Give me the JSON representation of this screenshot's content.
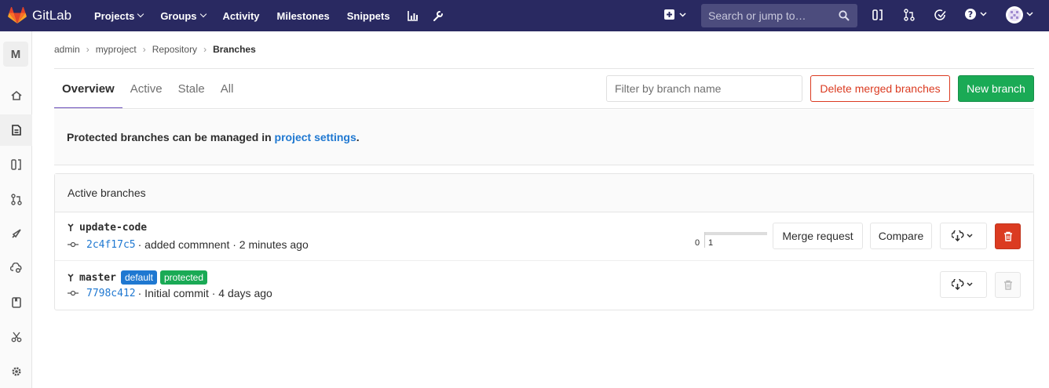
{
  "topbar": {
    "brand": "GitLab",
    "nav": [
      "Projects",
      "Groups",
      "Activity",
      "Milestones",
      "Snippets"
    ],
    "search_placeholder": "Search or jump to…"
  },
  "sidebar": {
    "project_letter": "M"
  },
  "breadcrumb": [
    "admin",
    "myproject",
    "Repository",
    "Branches"
  ],
  "tabs": [
    "Overview",
    "Active",
    "Stale",
    "All"
  ],
  "filter_placeholder": "Filter by branch name",
  "buttons": {
    "delete_merged": "Delete merged branches",
    "new_branch": "New branch"
  },
  "info": {
    "text": "Protected branches can be managed in ",
    "link": "project settings",
    "end": "."
  },
  "panel_title": "Active branches",
  "branches": [
    {
      "name": "update-code",
      "sha": "2c4f17c5",
      "message": "· added commnent · 2 minutes ago",
      "behind": "0",
      "ahead": "1",
      "merge_request": "Merge request",
      "compare": "Compare"
    },
    {
      "name": "master",
      "sha": "7798c412",
      "message": "· Initial commit · 4 days ago",
      "badges": [
        "default",
        "protected"
      ]
    }
  ],
  "colors": {
    "topbar": "#292961",
    "accent": "#6b4fbb",
    "success": "#1aaa55",
    "danger": "#db3b21",
    "link": "#1f78d1"
  }
}
